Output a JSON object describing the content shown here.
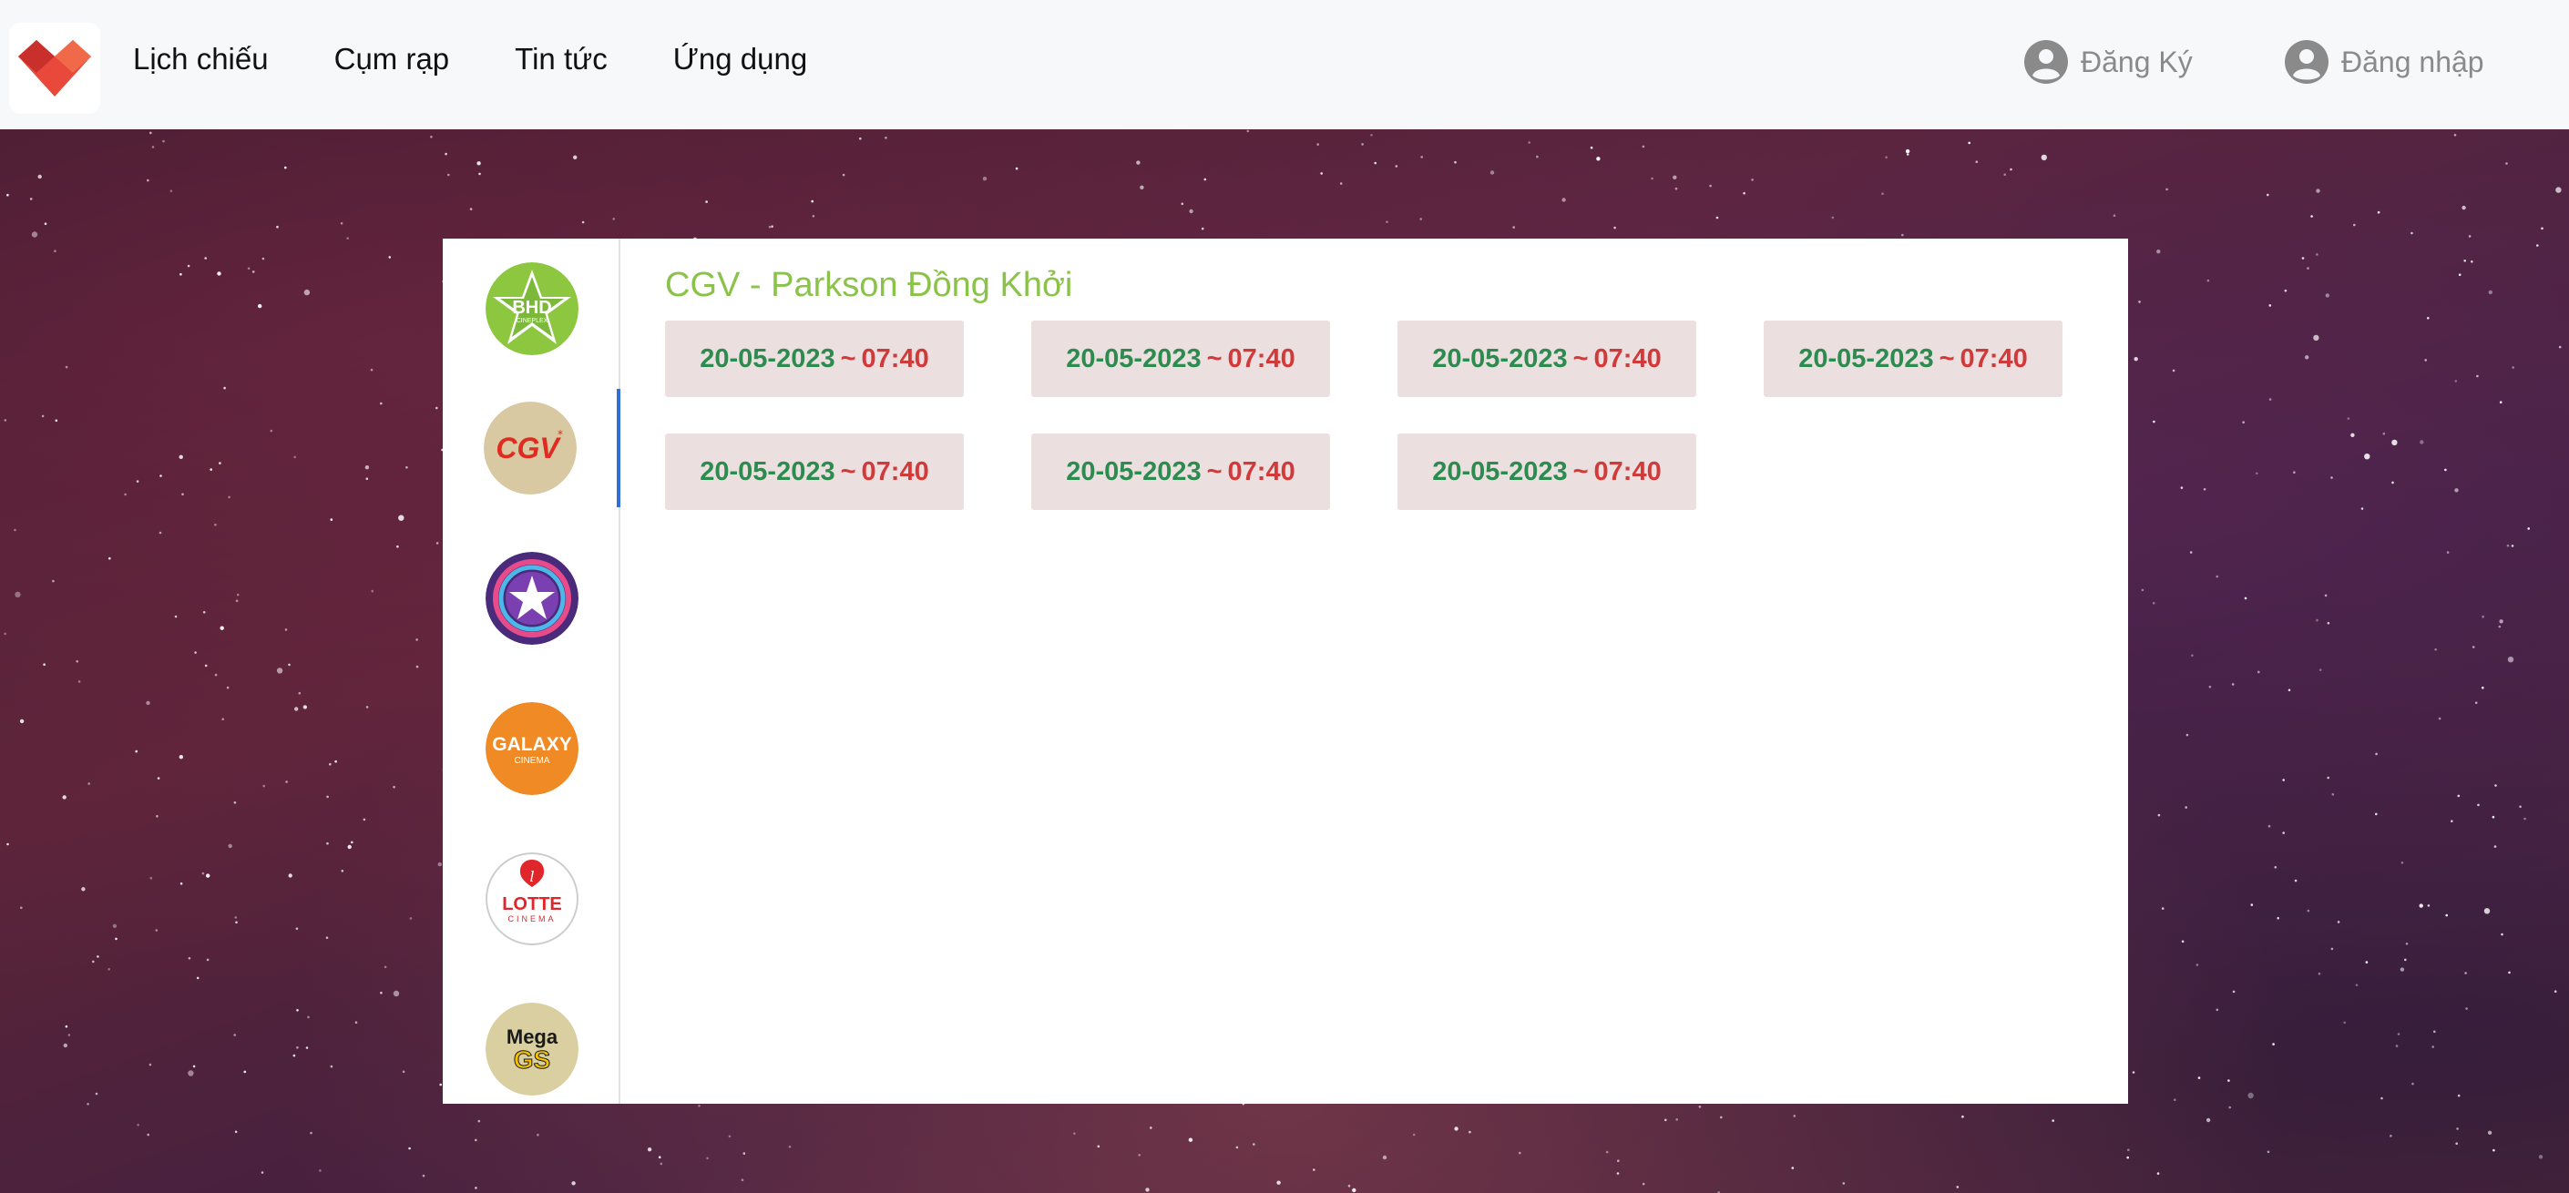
{
  "nav": {
    "items": [
      "Lịch chiếu",
      "Cụm rạp",
      "Tin tức",
      "Ứng dụng"
    ]
  },
  "auth": {
    "register_label": "Đăng Ký",
    "login_label": "Đăng nhập"
  },
  "brands": [
    {
      "name": "BHD Star Cineplex",
      "logo_text": "BHD",
      "logo_sub": "CINEPLEX",
      "icon": "bhd-star-logo",
      "active": false
    },
    {
      "name": "CGV",
      "logo_text": "CGV",
      "icon": "cgv-logo",
      "active": true
    },
    {
      "name": "CineStar",
      "icon": "cinestar-logo",
      "active": false
    },
    {
      "name": "Galaxy Cinema",
      "logo_text": "GALAXY",
      "logo_sub": "CINEMA",
      "icon": "galaxy-logo",
      "active": false
    },
    {
      "name": "Lotte Cinema",
      "logo_text": "LOTTE",
      "logo_sub": "CINEMA",
      "icon": "lotte-logo",
      "active": false
    },
    {
      "name": "MegaGS",
      "logo_text": "Mega",
      "logo_sub": "GS",
      "icon": "megags-logo",
      "active": false
    }
  ],
  "cinema": {
    "title": "CGV - Parkson Đồng Khởi"
  },
  "showtimes": [
    {
      "date": "20-05-2023",
      "sep": "~",
      "time": "07:40"
    },
    {
      "date": "20-05-2023",
      "sep": "~",
      "time": "07:40"
    },
    {
      "date": "20-05-2023",
      "sep": "~",
      "time": "07:40"
    },
    {
      "date": "20-05-2023",
      "sep": "~",
      "time": "07:40"
    },
    {
      "date": "20-05-2023",
      "sep": "~",
      "time": "07:40"
    },
    {
      "date": "20-05-2023",
      "sep": "~",
      "time": "07:40"
    },
    {
      "date": "20-05-2023",
      "sep": "~",
      "time": "07:40"
    }
  ],
  "colors": {
    "title_green": "#8bc34a",
    "date_green": "#2e8b4f",
    "time_red": "#d23a3a",
    "chip_bg": "#ecdfe0",
    "active_indicator": "#2f6fd6"
  }
}
